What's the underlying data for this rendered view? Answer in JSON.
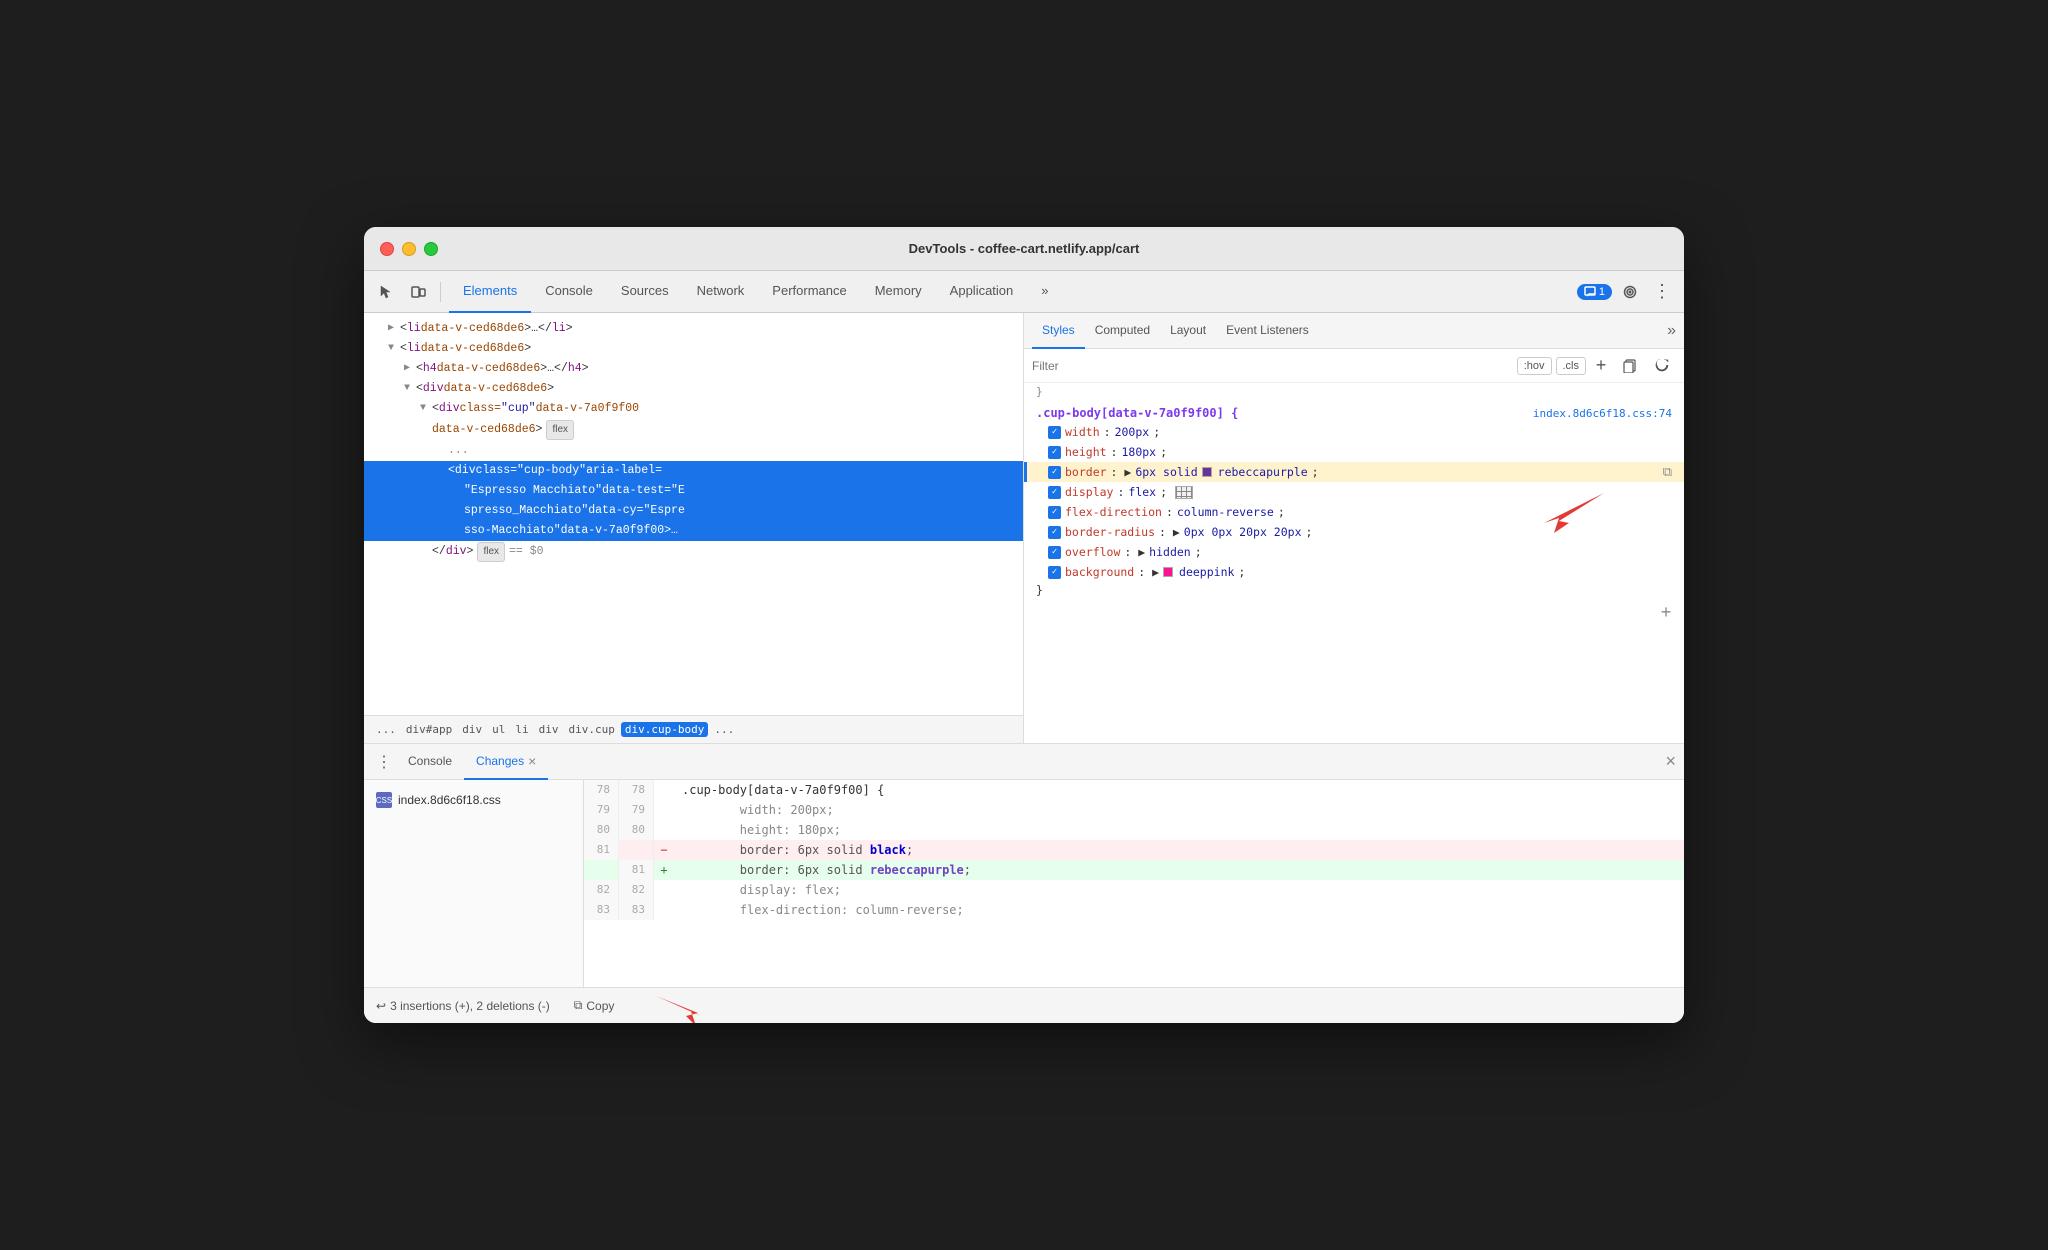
{
  "window": {
    "title": "DevTools - coffee-cart.netlify.app/cart"
  },
  "toolbar": {
    "tabs": [
      "Elements",
      "Console",
      "Sources",
      "Network",
      "Performance",
      "Memory",
      "Application"
    ],
    "active_tab": "Elements",
    "badge_label": "1",
    "more_label": "»"
  },
  "dom": {
    "lines": [
      {
        "indent": 1,
        "arrow": "collapsed",
        "content": "<li data-v-ced68de6>…</li>"
      },
      {
        "indent": 1,
        "arrow": "expanded",
        "content": "<li data-v-ced68de6>"
      },
      {
        "indent": 2,
        "arrow": "collapsed",
        "content": "<h4 data-v-ced68de6>…</h4>"
      },
      {
        "indent": 2,
        "arrow": "expanded",
        "content": "<div data-v-ced68de6>"
      },
      {
        "indent": 3,
        "arrow": "expanded",
        "content": "<div class=\"cup\" data-v-7a0f9f00"
      },
      {
        "indent": 3,
        "arrow": "none",
        "content": "data-v-ced68de6>",
        "badge": "flex"
      },
      {
        "indent": 4,
        "arrow": "none",
        "content": "..."
      },
      {
        "indent": 5,
        "arrow": "none",
        "content": "<div class=\"cup-body\" aria-label="
      },
      {
        "indent": 5,
        "arrow": "none",
        "content": "\"Espresso Macchiato\" data-test=\"E"
      },
      {
        "indent": 5,
        "arrow": "none",
        "content": "spresso_Macchiato\" data-cy=\"Espre"
      },
      {
        "indent": 5,
        "arrow": "none",
        "content": "sso-Macchiato\" data-v-7a0f9f00>…"
      },
      {
        "indent": 4,
        "arrow": "none",
        "content": "</div>",
        "badge": "flex",
        "dollar": "== $0"
      }
    ]
  },
  "breadcrumb": {
    "items": [
      "...",
      "div#app",
      "div",
      "ul",
      "li",
      "div",
      "div.cup",
      "div.cup-body"
    ],
    "active": "div.cup-body",
    "ellipsis": "..."
  },
  "styles_panel": {
    "tabs": [
      "Styles",
      "Computed",
      "Layout",
      "Event Listeners"
    ],
    "active_tab": "Styles",
    "more_label": "»",
    "filter_placeholder": "Filter",
    "filter_btns": [
      ":hov",
      ".cls",
      "+"
    ],
    "rule": {
      "selector": ".cup-body[data-v-7a0f9f00] {",
      "source": "index.8d6c6f18.css:74",
      "properties": [
        {
          "name": "width",
          "value": "200px",
          "checked": true,
          "highlighted": false
        },
        {
          "name": "height",
          "value": "180px",
          "checked": true,
          "highlighted": false
        },
        {
          "name": "border",
          "value": "6px solid",
          "color": "#663399",
          "color_name": "rebeccapurple",
          "checked": true,
          "highlighted": true
        },
        {
          "name": "display",
          "value": "flex",
          "checked": true,
          "highlighted": false,
          "has_icon": true
        },
        {
          "name": "flex-direction",
          "value": "column-reverse",
          "checked": true,
          "highlighted": false
        },
        {
          "name": "border-radius",
          "value": "0px 0px 20px 20px",
          "checked": true,
          "highlighted": false
        },
        {
          "name": "overflow",
          "value": "hidden",
          "checked": true,
          "highlighted": false
        },
        {
          "name": "background",
          "value": "deeppink",
          "color": "#ff1493",
          "checked": true,
          "highlighted": false
        }
      ]
    }
  },
  "bottom_panel": {
    "tabs": [
      "Console",
      "Changes"
    ],
    "active_tab": "Changes",
    "file": "index.8d6c6f18.css",
    "diff_lines": [
      {
        "old_num": "78",
        "new_num": "78",
        "type": "context",
        "code": "    .cup-body[data-v-7a0f9f00] {"
      },
      {
        "old_num": "79",
        "new_num": "79",
        "type": "context",
        "code": "        width: 200px;"
      },
      {
        "old_num": "80",
        "new_num": "80",
        "type": "context",
        "code": "        height: 180px;"
      },
      {
        "old_num": "81",
        "new_num": "",
        "type": "removed",
        "code": "        border: 6px solid black;"
      },
      {
        "old_num": "",
        "new_num": "81",
        "type": "added",
        "code": "        border: 6px solid rebeccapurple;"
      },
      {
        "old_num": "82",
        "new_num": "82",
        "type": "context",
        "code": "        display: flex;"
      },
      {
        "old_num": "83",
        "new_num": "83",
        "type": "context",
        "code": "        flex-direction: column-reverse;"
      }
    ],
    "status": {
      "undo_label": "↩",
      "changes_text": "3 insertions (+), 2 deletions (-)",
      "copy_icon": "⧉",
      "copy_label": "Copy"
    }
  },
  "arrows": {
    "styles_arrow_text": "▼",
    "bottom_arrow_text": "▼"
  }
}
